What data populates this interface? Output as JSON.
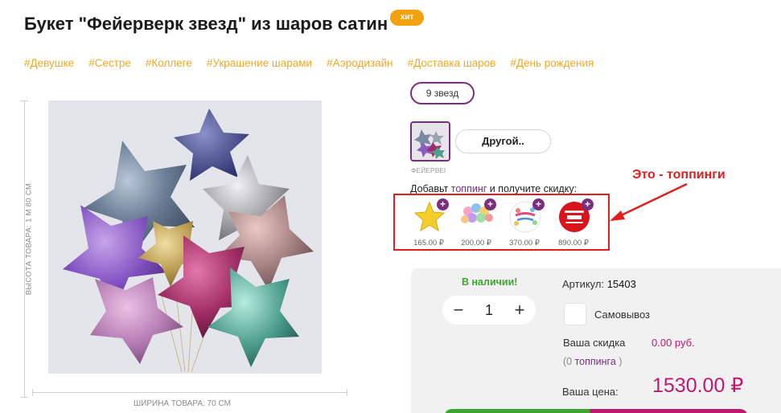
{
  "product": {
    "title": "Букет \"Фейерверк звезд\" из шаров сатин",
    "badge": "хит"
  },
  "tags": [
    "#Девушке",
    "#Сестре",
    "#Коллеге",
    "#Украшение шарами",
    "#Аэродизайн",
    "#Доставка шаров",
    "#День рождения"
  ],
  "photo": {
    "height_label": "ВЫСОТА ТОВАРА: 1 М 80 СМ",
    "width_label": "ШИРИНА ТОВАРА: 70 СМ"
  },
  "options": {
    "stars_label": "9 звезд",
    "variant_label": "ФЕЙЕРВЕІ",
    "other_button": "Другой.."
  },
  "toppings": {
    "prompt_before": "Добавьт ",
    "prompt_link": "топпинг",
    "prompt_after": " и получите скидку:",
    "items": [
      {
        "price": "165.00 ₽",
        "icon": "gold-star-balloon-icon",
        "plus": "+"
      },
      {
        "price": "200.00 ₽",
        "icon": "balloon-bunch-icon",
        "plus": "+"
      },
      {
        "price": "370.00 ₽",
        "icon": "happy-birthday-balloon-icon",
        "plus": "+"
      },
      {
        "price": "890.00 ₽",
        "icon": "red-greeting-balloon-icon",
        "plus": "+"
      }
    ],
    "highlight_color": "#e0201f"
  },
  "annotation": {
    "text": "Это - топпинги"
  },
  "purchase": {
    "stock": "В наличии!",
    "qty_minus": "−",
    "quantity": "1",
    "qty_plus": "+",
    "sku_label": "Артикул: ",
    "sku_value": "15403",
    "pickup_label": "Самовывоз",
    "discount_label": "Ваша скидка",
    "discount_value": "0.00 руб.",
    "topping_count_open": "(0 ",
    "topping_count_link": "топпинга",
    "topping_count_close": " )",
    "price_label": "Ваша цена:",
    "price_value": "1530.00 ₽"
  },
  "colors": {
    "accent_purple": "#7b2d7e",
    "tag_orange": "#f0a826",
    "badge_orange": "#f2a20c",
    "price_magenta": "#c0186e",
    "stock_green": "#3aa62e"
  }
}
